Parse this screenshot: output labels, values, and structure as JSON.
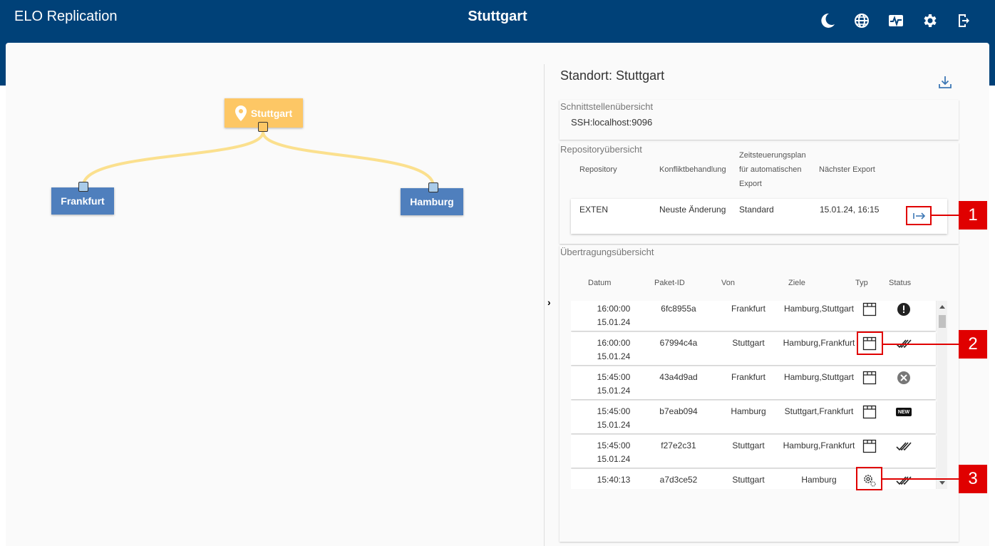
{
  "header": {
    "app_title": "ELO Replication",
    "location_title": "Stuttgart",
    "icons": [
      "moon-icon",
      "globe-icon",
      "activity-icon",
      "gear-icon",
      "logout-icon"
    ]
  },
  "graph": {
    "nodes": {
      "stuttgart": "Stuttgart",
      "frankfurt": "Frankfurt",
      "hamburg": "Hamburg"
    },
    "colors": {
      "main_node": "#fdc765",
      "child_node": "#4f7fbd",
      "edge": "#fbe08e"
    }
  },
  "panel": {
    "title": "Standort: Stuttgart",
    "interface": {
      "label": "Schnittstellenübersicht",
      "value": "SSH:localhost:9096"
    },
    "repository": {
      "label": "Repositoryübersicht",
      "headers": {
        "repository": "Repository",
        "conflict": "Konfliktbehandlung",
        "schedule_1": "Zeitsteuerungsplan",
        "schedule_2": "für automatischen",
        "schedule_3": "Export",
        "next_export": "Nächster Export"
      },
      "row": {
        "repository": "EXTEN",
        "conflict": "Neuste Änderung",
        "schedule": "Standard",
        "next_export": "15.01.24, 16:15"
      }
    },
    "transfer": {
      "label": "Übertragungsübersicht",
      "headers": {
        "date": "Datum",
        "package": "Paket-ID",
        "from": "Von",
        "targets": "Ziele",
        "type": "Typ",
        "status": "Status"
      },
      "rows": [
        {
          "time": "16:00:00",
          "date": "15.01.24",
          "package": "6fc8955a",
          "from": "Frankfurt",
          "targets": "Hamburg,Stuttgart",
          "type": "package",
          "status": "error"
        },
        {
          "time": "16:00:00",
          "date": "15.01.24",
          "package": "67994c4a",
          "from": "Stuttgart",
          "targets": "Hamburg,Frankfurt",
          "type": "package",
          "status": "done"
        },
        {
          "time": "15:45:00",
          "date": "15.01.24",
          "package": "43a4d9ad",
          "from": "Frankfurt",
          "targets": "Hamburg,Stuttgart",
          "type": "package",
          "status": "failed"
        },
        {
          "time": "15:45:00",
          "date": "15.01.24",
          "package": "b7eab094",
          "from": "Hamburg",
          "targets": "Stuttgart,Frankfurt",
          "type": "package",
          "status": "new"
        },
        {
          "time": "15:45:00",
          "date": "15.01.24",
          "package": "f27e2c31",
          "from": "Stuttgart",
          "targets": "Hamburg,Frankfurt",
          "type": "package",
          "status": "done"
        },
        {
          "time": "15:40:13",
          "date": "15.01.24",
          "package": "a7d3ce52",
          "from": "Stuttgart",
          "targets": "Hamburg",
          "type": "settings",
          "status": "done"
        }
      ],
      "new_badge": "NEW"
    }
  },
  "callouts": [
    "1",
    "2",
    "3"
  ]
}
